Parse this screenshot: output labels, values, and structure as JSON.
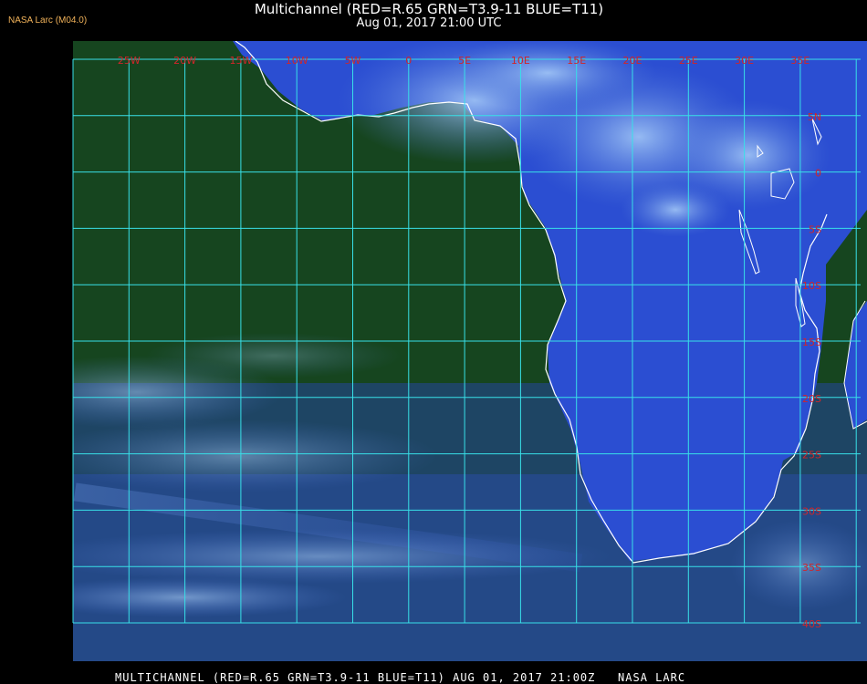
{
  "header": {
    "badge": "NASA Larc (M04.0)",
    "title": "Multichannel (RED=R.65 GRN=T3.9-11 BLUE=T11)",
    "subtitle": "Aug 01, 2017 21:00 UTC"
  },
  "map": {
    "lon_labels": [
      "25W",
      "20W",
      "15W",
      "10W",
      "5W",
      "0",
      "5E",
      "10E",
      "15E",
      "20E",
      "25E",
      "30E",
      "35E"
    ],
    "lat_labels": [
      "5N",
      "0",
      "5S",
      "10S",
      "15S",
      "20S",
      "25S",
      "30S",
      "35S",
      "40S"
    ],
    "colors": {
      "grid": "#38e0e8",
      "label": "#d0262a",
      "coast": "#ffffff",
      "ocean": "#16451f",
      "land": "#2d4fd0",
      "cloud": "#8ab8f0"
    }
  },
  "footer": {
    "text": "MULTICHANNEL (RED=R.65 GRN=T3.9-11 BLUE=T11) AUG 01, 2017 21:00Z   NASA LARC"
  }
}
